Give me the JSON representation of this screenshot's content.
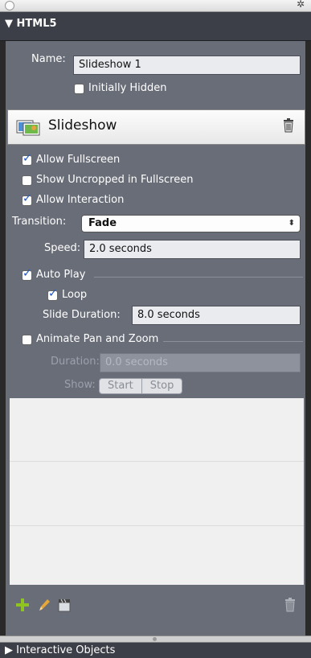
{
  "section": {
    "title": "▼ HTML5"
  },
  "name_label": "Name:",
  "name_value": "Slideshow 1",
  "initially_hidden": {
    "label": "Initially Hidden",
    "checked": false
  },
  "slideshow": {
    "title": "Slideshow"
  },
  "options": {
    "allow_fullscreen": {
      "label": "Allow Fullscreen",
      "checked": true
    },
    "show_uncropped": {
      "label": "Show Uncropped in Fullscreen",
      "checked": false
    },
    "allow_interaction": {
      "label": "Allow Interaction",
      "checked": true
    }
  },
  "transition": {
    "label": "Transition:",
    "value": "Fade",
    "arrows": "⬍"
  },
  "speed": {
    "label": "Speed:",
    "value": "2.0 seconds"
  },
  "auto_play": {
    "label": "Auto Play",
    "checked": true
  },
  "loop": {
    "label": "Loop",
    "checked": true
  },
  "slide_duration": {
    "label": "Slide Duration:",
    "value": "8.0 seconds"
  },
  "animate_pan_zoom": {
    "label": "Animate Pan and Zoom",
    "checked": false
  },
  "duration": {
    "label": "Duration:",
    "value": "0.0 seconds"
  },
  "show": {
    "label": "Show:",
    "start": "Start",
    "stop": "Stop"
  },
  "footer": {
    "title": "▶ Interactive Objects"
  },
  "colors": {
    "panel": "#696d78",
    "header": "#3c3f47",
    "accent": "#8fc31f"
  },
  "icons": [
    "gear-icon",
    "slideshow-icon",
    "trash-icon",
    "add-icon",
    "pencil-icon",
    "clapboard-icon"
  ]
}
